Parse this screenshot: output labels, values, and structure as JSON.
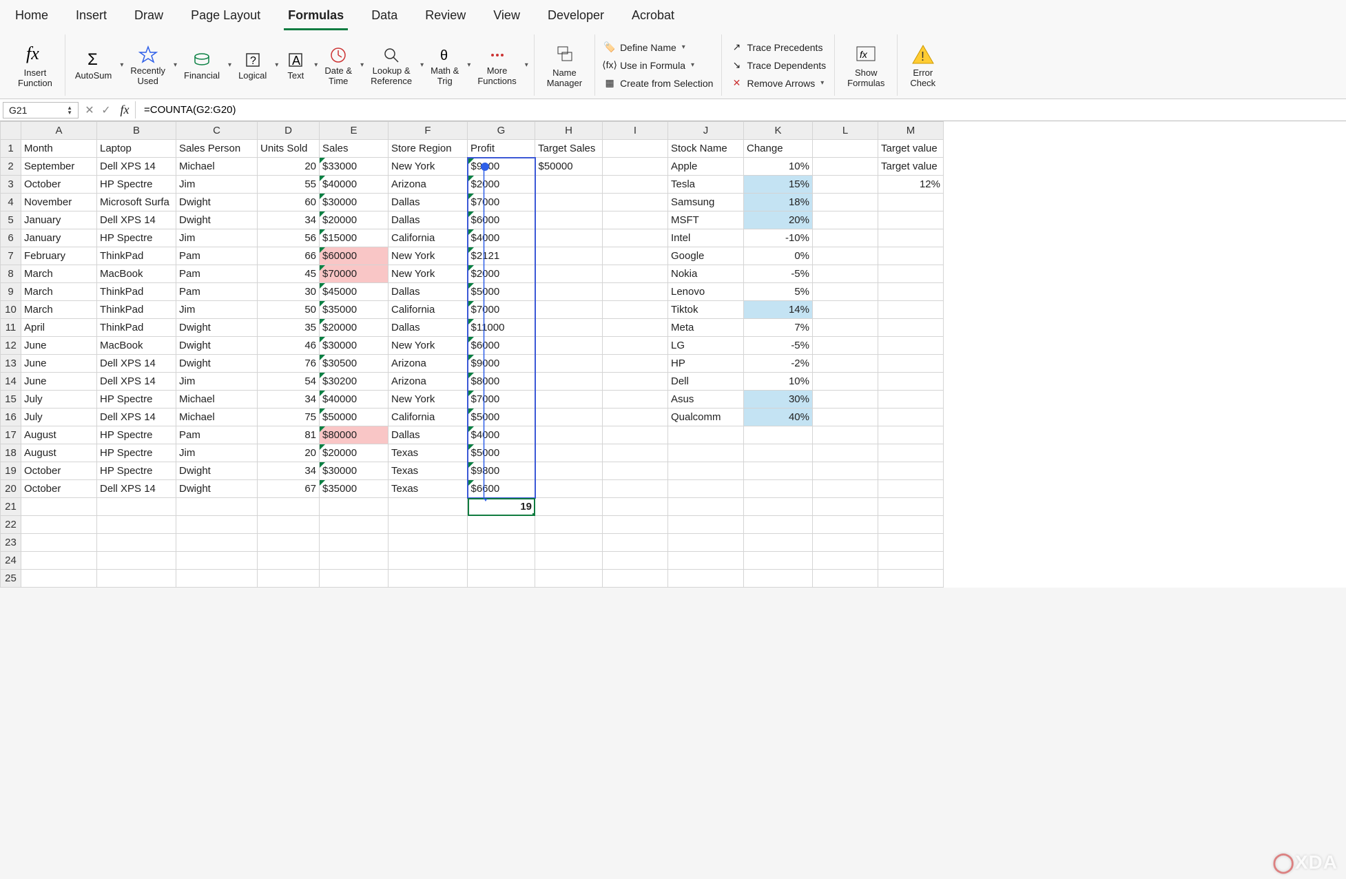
{
  "tabs": [
    "Home",
    "Insert",
    "Draw",
    "Page Layout",
    "Formulas",
    "Data",
    "Review",
    "View",
    "Developer",
    "Acrobat"
  ],
  "active_tab": "Formulas",
  "ribbon": {
    "insert_function": "Insert\nFunction",
    "autosum": "AutoSum",
    "recently_used": "Recently\nUsed",
    "financial": "Financial",
    "logical": "Logical",
    "text": "Text",
    "date_time": "Date &\nTime",
    "lookup_ref": "Lookup &\nReference",
    "math_trig": "Math &\nTrig",
    "more_functions": "More\nFunctions",
    "name_manager": "Name\nManager",
    "define_name": "Define Name",
    "use_in_formula": "Use in Formula",
    "create_from_selection": "Create from Selection",
    "trace_precedents": "Trace Precedents",
    "trace_dependents": "Trace Dependents",
    "remove_arrows": "Remove Arrows",
    "show_formulas": "Show\nFormulas",
    "error_checking": "Error\nCheck"
  },
  "name_box": "G21",
  "formula": "=COUNTA(G2:G20)",
  "columns": [
    "A",
    "B",
    "C",
    "D",
    "E",
    "F",
    "G",
    "H",
    "I",
    "J",
    "K",
    "L",
    "M"
  ],
  "headers": {
    "A": "Month",
    "B": "Laptop",
    "C": "Sales Person",
    "D": "Units Sold",
    "E": "Sales",
    "F": "Store Region",
    "G": "Profit",
    "H": "Target Sales",
    "J": "Stock Name",
    "K": "Change",
    "M": "Target value"
  },
  "rows": [
    {
      "r": 2,
      "A": "September",
      "B": "Dell XPS 14",
      "C": "Michael",
      "D": "20",
      "E": "$33000",
      "F": "New York",
      "G": "$9000",
      "H": "$50000",
      "J": "Apple",
      "K": "10%"
    },
    {
      "r": 3,
      "A": "October",
      "B": "HP Spectre",
      "C": "Jim",
      "D": "55",
      "E": "$40000",
      "F": "Arizona",
      "G": "$2000",
      "J": "Tesla",
      "K": "15%",
      "K_hl": "blue",
      "M": "12%"
    },
    {
      "r": 4,
      "A": "November",
      "B": "Microsoft Surfa",
      "C": "Dwight",
      "D": "60",
      "E": "$30000",
      "F": "Dallas",
      "G": "$7000",
      "J": "Samsung",
      "K": "18%",
      "K_hl": "blue"
    },
    {
      "r": 5,
      "A": "January",
      "B": "Dell XPS 14",
      "C": "Dwight",
      "D": "34",
      "E": "$20000",
      "F": "Dallas",
      "G": "$6000",
      "J": "MSFT",
      "K": "20%",
      "K_hl": "blue"
    },
    {
      "r": 6,
      "A": "January",
      "B": "HP Spectre",
      "C": "Jim",
      "D": "56",
      "E": "$15000",
      "F": "California",
      "G": "$4000",
      "J": "Intel",
      "K": "-10%"
    },
    {
      "r": 7,
      "A": "February",
      "B": "ThinkPad",
      "C": "Pam",
      "D": "66",
      "E": "$60000",
      "E_hl": "red",
      "F": "New York",
      "G": "$2121",
      "J": "Google",
      "K": "0%"
    },
    {
      "r": 8,
      "A": "March",
      "B": "MacBook",
      "C": "Pam",
      "D": "45",
      "E": "$70000",
      "E_hl": "red",
      "F": "New York",
      "G": "$2000",
      "J": "Nokia",
      "K": "-5%"
    },
    {
      "r": 9,
      "A": "March",
      "B": "ThinkPad",
      "C": "Pam",
      "D": "30",
      "E": "$45000",
      "F": "Dallas",
      "G": "$5000",
      "J": "Lenovo",
      "K": "5%"
    },
    {
      "r": 10,
      "A": "March",
      "B": "ThinkPad",
      "C": "Jim",
      "D": "50",
      "E": "$35000",
      "F": "California",
      "G": "$7000",
      "J": "Tiktok",
      "K": "14%",
      "K_hl": "blue"
    },
    {
      "r": 11,
      "A": "April",
      "B": "ThinkPad",
      "C": "Dwight",
      "D": "35",
      "E": "$20000",
      "F": "Dallas",
      "G": "$11000",
      "J": "Meta",
      "K": "7%"
    },
    {
      "r": 12,
      "A": "June",
      "B": "MacBook",
      "C": "Dwight",
      "D": "46",
      "E": "$30000",
      "F": "New York",
      "G": "$6000",
      "J": "LG",
      "K": "-5%"
    },
    {
      "r": 13,
      "A": "June",
      "B": "Dell XPS 14",
      "C": "Dwight",
      "D": "76",
      "E": "$30500",
      "F": "Arizona",
      "G": "$9000",
      "J": "HP",
      "K": "-2%"
    },
    {
      "r": 14,
      "A": "June",
      "B": "Dell XPS 14",
      "C": "Jim",
      "D": "54",
      "E": "$30200",
      "F": "Arizona",
      "G": "$8000",
      "J": "Dell",
      "K": "10%"
    },
    {
      "r": 15,
      "A": "July",
      "B": "HP Spectre",
      "C": "Michael",
      "D": "34",
      "E": "$40000",
      "F": "New York",
      "G": "$7000",
      "J": "Asus",
      "K": "30%",
      "K_hl": "blue"
    },
    {
      "r": 16,
      "A": "July",
      "B": "Dell XPS 14",
      "C": "Michael",
      "D": "75",
      "E": "$50000",
      "F": "California",
      "G": "$5000",
      "J": "Qualcomm",
      "K": "40%",
      "K_hl": "blue"
    },
    {
      "r": 17,
      "A": "August",
      "B": "HP Spectre",
      "C": "Pam",
      "D": "81",
      "E": "$80000",
      "E_hl": "red",
      "F": "Dallas",
      "G": "$4000"
    },
    {
      "r": 18,
      "A": "August",
      "B": "HP Spectre",
      "C": "Jim",
      "D": "20",
      "E": "$20000",
      "F": "Texas",
      "G": "$5000"
    },
    {
      "r": 19,
      "A": "October",
      "B": "HP Spectre",
      "C": "Dwight",
      "D": "34",
      "E": "$30000",
      "F": "Texas",
      "G": "$9800"
    },
    {
      "r": 20,
      "A": "October",
      "B": "Dell XPS 14",
      "C": "Dwight",
      "D": "67",
      "E": "$35000",
      "F": "Texas",
      "G": "$6600"
    }
  ],
  "result_cell": {
    "row": 21,
    "col": "G",
    "value": "19"
  },
  "trace_range": {
    "col": "G",
    "from": 2,
    "to": 20
  },
  "extra_rows": [
    21,
    22,
    23,
    24,
    25
  ],
  "m_row2": "Target value",
  "watermark": "XDA"
}
